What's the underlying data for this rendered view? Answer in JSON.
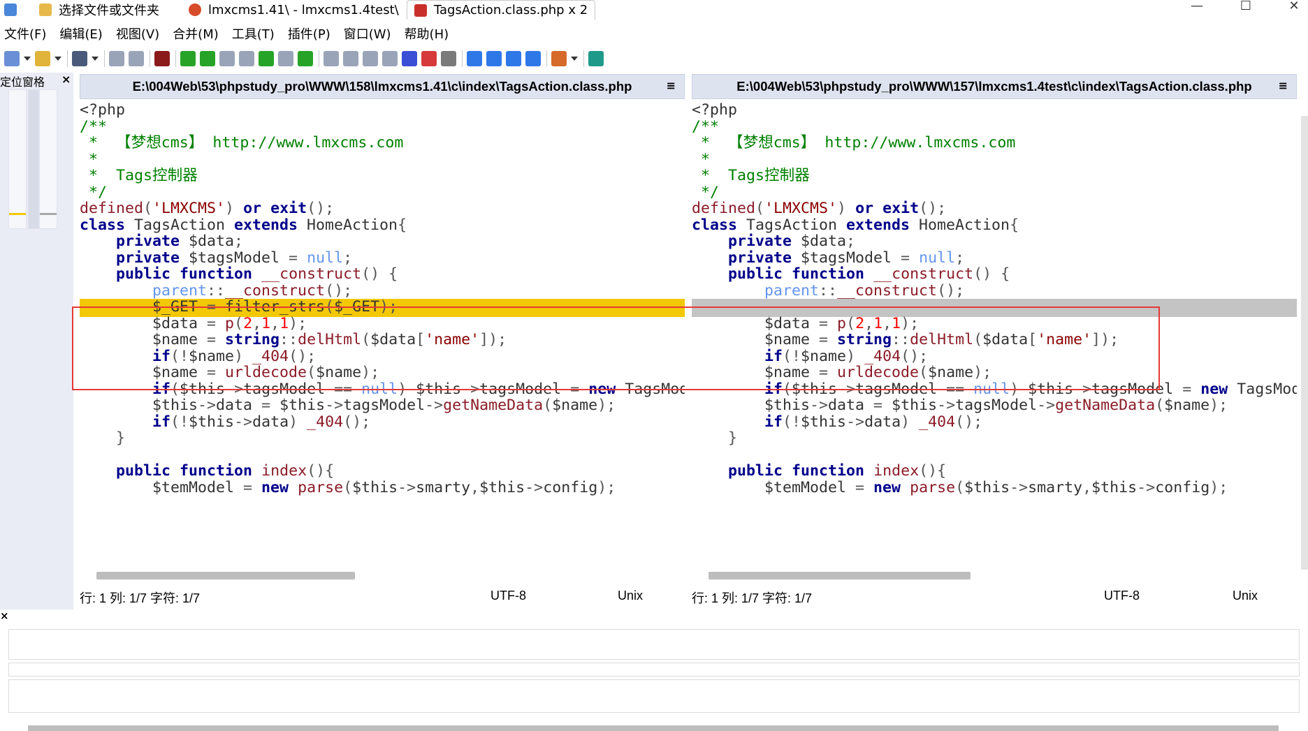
{
  "window": {
    "tabs": [
      {
        "label": "选择文件或文件夹",
        "icon": "folder-compare-icon"
      },
      {
        "label": "lmxcms1.41\\ - lmxcms1.4test\\",
        "icon": "warning-icon"
      },
      {
        "label": "TagsAction.class.php x 2",
        "icon": "file-compare-icon",
        "active": true
      }
    ],
    "controls": {
      "minimize": "—",
      "maximize": "☐",
      "close": "✕"
    }
  },
  "menu": [
    "文件(F)",
    "编辑(E)",
    "视图(V)",
    "合并(M)",
    "工具(T)",
    "插件(P)",
    "窗口(W)",
    "帮助(H)"
  ],
  "locator": {
    "title": "定位窗格",
    "close": "×"
  },
  "panes": {
    "left": {
      "path": "E:\\004Web\\53\\phpstudy_pro\\WWW\\158\\lmxcms1.41\\c\\index\\TagsAction.class.php",
      "menu": "≡",
      "status": {
        "position": "行: 1  列: 1/7  字符: 1/7",
        "encoding": "UTF-8",
        "eol": "Unix"
      },
      "highlight": {
        "line": 12,
        "color": "#f2c807"
      }
    },
    "right": {
      "path": "E:\\004Web\\53\\phpstudy_pro\\WWW\\157\\lmxcms1.4test\\c\\index\\TagsAction.class.php",
      "menu": "≡",
      "status": {
        "position": "行: 1  列: 1/7  字符: 1/7",
        "encoding": "UTF-8",
        "eol": "Unix"
      },
      "highlight": {
        "line": 12,
        "color": "#c4c4c4"
      }
    }
  },
  "code": {
    "left": [
      [
        [
          "tx",
          "<?php"
        ]
      ],
      [
        [
          "cm",
          "/**"
        ]
      ],
      [
        [
          "cm",
          " *  【梦想cms】 http://www.lmxcms.com"
        ]
      ],
      [
        [
          "cm",
          " *"
        ]
      ],
      [
        [
          "cm",
          " *  Tags控制器"
        ]
      ],
      [
        [
          "cm",
          " */"
        ]
      ],
      [
        [
          "fn",
          "defined"
        ],
        [
          "op",
          "("
        ],
        [
          "st",
          "'LMXCMS'"
        ],
        [
          "op",
          ") "
        ],
        [
          "kw",
          "or"
        ],
        [
          "op",
          " "
        ],
        [
          "kw",
          "exit"
        ],
        [
          "op",
          "();"
        ]
      ],
      [
        [
          "kw",
          "class"
        ],
        [
          "tx",
          " TagsAction "
        ],
        [
          "kw",
          "extends"
        ],
        [
          "tx",
          " HomeAction"
        ],
        [
          "op",
          "{"
        ]
      ],
      [
        [
          "tx",
          "    "
        ],
        [
          "kw",
          "private"
        ],
        [
          "tx",
          " $data"
        ],
        [
          "op",
          ";"
        ]
      ],
      [
        [
          "tx",
          "    "
        ],
        [
          "kw",
          "private"
        ],
        [
          "tx",
          " $tagsModel "
        ],
        [
          "op",
          "= "
        ],
        [
          "pl",
          "null"
        ],
        [
          "op",
          ";"
        ]
      ],
      [
        [
          "tx",
          "    "
        ],
        [
          "kw",
          "public"
        ],
        [
          "tx",
          " "
        ],
        [
          "kw",
          "function"
        ],
        [
          "tx",
          " "
        ],
        [
          "fn",
          "__construct"
        ],
        [
          "op",
          "() {"
        ]
      ],
      [
        [
          "tx",
          "        "
        ],
        [
          "pl",
          "parent"
        ],
        [
          "op",
          "::"
        ],
        [
          "fn",
          "__construct"
        ],
        [
          "op",
          "();"
        ]
      ],
      [
        [
          "tx",
          "        $_GET "
        ],
        [
          "op",
          "= "
        ],
        [
          "tx",
          "filter_strs"
        ],
        [
          "op",
          "("
        ],
        [
          "tx",
          "$_GET"
        ],
        [
          "op",
          ");"
        ]
      ],
      [
        [
          "tx",
          "        $data "
        ],
        [
          "op",
          "= "
        ],
        [
          "fn",
          "p"
        ],
        [
          "op",
          "("
        ],
        [
          "nu",
          "2"
        ],
        [
          "op",
          ","
        ],
        [
          "nu",
          "1"
        ],
        [
          "op",
          ","
        ],
        [
          "nu",
          "1"
        ],
        [
          "op",
          ");"
        ]
      ],
      [
        [
          "tx",
          "        $name "
        ],
        [
          "op",
          "= "
        ],
        [
          "kw",
          "string"
        ],
        [
          "op",
          "::"
        ],
        [
          "fn",
          "delHtml"
        ],
        [
          "op",
          "("
        ],
        [
          "tx",
          "$data"
        ],
        [
          "op",
          "["
        ],
        [
          "st",
          "'name'"
        ],
        [
          "op",
          "]);"
        ]
      ],
      [
        [
          "tx",
          "        "
        ],
        [
          "kw",
          "if"
        ],
        [
          "op",
          "(!"
        ],
        [
          "tx",
          "$name"
        ],
        [
          "op",
          ") "
        ],
        [
          "fn",
          "_404"
        ],
        [
          "op",
          "();"
        ]
      ],
      [
        [
          "tx",
          "        $name "
        ],
        [
          "op",
          "= "
        ],
        [
          "fn",
          "urldecode"
        ],
        [
          "op",
          "("
        ],
        [
          "tx",
          "$name"
        ],
        [
          "op",
          ");"
        ]
      ],
      [
        [
          "tx",
          "        "
        ],
        [
          "kw",
          "if"
        ],
        [
          "op",
          "("
        ],
        [
          "tx",
          "$this"
        ],
        [
          "op",
          "->"
        ],
        [
          "tx",
          "tagsModel "
        ],
        [
          "op",
          "== "
        ],
        [
          "pl",
          "null"
        ],
        [
          "op",
          ") "
        ],
        [
          "tx",
          "$this"
        ],
        [
          "op",
          "->"
        ],
        [
          "tx",
          "tagsModel "
        ],
        [
          "op",
          "= "
        ],
        [
          "kw",
          "new"
        ],
        [
          "tx",
          " TagsModel();"
        ]
      ],
      [
        [
          "tx",
          "        $this"
        ],
        [
          "op",
          "->"
        ],
        [
          "tx",
          "data "
        ],
        [
          "op",
          "= "
        ],
        [
          "tx",
          "$this"
        ],
        [
          "op",
          "->"
        ],
        [
          "tx",
          "tagsModel"
        ],
        [
          "op",
          "->"
        ],
        [
          "fn",
          "getNameData"
        ],
        [
          "op",
          "("
        ],
        [
          "tx",
          "$name"
        ],
        [
          "op",
          ");"
        ]
      ],
      [
        [
          "tx",
          "        "
        ],
        [
          "kw",
          "if"
        ],
        [
          "op",
          "(!"
        ],
        [
          "tx",
          "$this"
        ],
        [
          "op",
          "->"
        ],
        [
          "tx",
          "data"
        ],
        [
          "op",
          ") "
        ],
        [
          "fn",
          "_404"
        ],
        [
          "op",
          "();"
        ]
      ],
      [
        [
          "op",
          "    }"
        ]
      ],
      [
        [
          "tx",
          ""
        ]
      ],
      [
        [
          "tx",
          "    "
        ],
        [
          "kw",
          "public"
        ],
        [
          "tx",
          " "
        ],
        [
          "kw",
          "function"
        ],
        [
          "tx",
          " "
        ],
        [
          "fn",
          "index"
        ],
        [
          "op",
          "(){"
        ]
      ],
      [
        [
          "tx",
          "        $temModel "
        ],
        [
          "op",
          "= "
        ],
        [
          "kw",
          "new"
        ],
        [
          "tx",
          " "
        ],
        [
          "fn",
          "parse"
        ],
        [
          "op",
          "("
        ],
        [
          "tx",
          "$this"
        ],
        [
          "op",
          "->"
        ],
        [
          "tx",
          "smarty"
        ],
        [
          "op",
          ","
        ],
        [
          "tx",
          "$this"
        ],
        [
          "op",
          "->"
        ],
        [
          "tx",
          "config"
        ],
        [
          "op",
          ");"
        ]
      ]
    ],
    "right": [
      [
        [
          "tx",
          "<?php"
        ]
      ],
      [
        [
          "cm",
          "/**"
        ]
      ],
      [
        [
          "cm",
          " *  【梦想cms】 http://www.lmxcms.com"
        ]
      ],
      [
        [
          "cm",
          " *"
        ]
      ],
      [
        [
          "cm",
          " *  Tags控制器"
        ]
      ],
      [
        [
          "cm",
          " */"
        ]
      ],
      [
        [
          "fn",
          "defined"
        ],
        [
          "op",
          "("
        ],
        [
          "st",
          "'LMXCMS'"
        ],
        [
          "op",
          ") "
        ],
        [
          "kw",
          "or"
        ],
        [
          "op",
          " "
        ],
        [
          "kw",
          "exit"
        ],
        [
          "op",
          "();"
        ]
      ],
      [
        [
          "kw",
          "class"
        ],
        [
          "tx",
          " TagsAction "
        ],
        [
          "kw",
          "extends"
        ],
        [
          "tx",
          " HomeAction"
        ],
        [
          "op",
          "{"
        ]
      ],
      [
        [
          "tx",
          "    "
        ],
        [
          "kw",
          "private"
        ],
        [
          "tx",
          " $data"
        ],
        [
          "op",
          ";"
        ]
      ],
      [
        [
          "tx",
          "    "
        ],
        [
          "kw",
          "private"
        ],
        [
          "tx",
          " $tagsModel "
        ],
        [
          "op",
          "= "
        ],
        [
          "pl",
          "null"
        ],
        [
          "op",
          ";"
        ]
      ],
      [
        [
          "tx",
          "    "
        ],
        [
          "kw",
          "public"
        ],
        [
          "tx",
          " "
        ],
        [
          "kw",
          "function"
        ],
        [
          "tx",
          " "
        ],
        [
          "fn",
          "__construct"
        ],
        [
          "op",
          "() {"
        ]
      ],
      [
        [
          "tx",
          "        "
        ],
        [
          "pl",
          "parent"
        ],
        [
          "op",
          "::"
        ],
        [
          "fn",
          "__construct"
        ],
        [
          "op",
          "();"
        ]
      ],
      [
        [
          "tx",
          ""
        ]
      ],
      [
        [
          "tx",
          "        $data "
        ],
        [
          "op",
          "= "
        ],
        [
          "fn",
          "p"
        ],
        [
          "op",
          "("
        ],
        [
          "nu",
          "2"
        ],
        [
          "op",
          ","
        ],
        [
          "nu",
          "1"
        ],
        [
          "op",
          ","
        ],
        [
          "nu",
          "1"
        ],
        [
          "op",
          ");"
        ]
      ],
      [
        [
          "tx",
          "        $name "
        ],
        [
          "op",
          "= "
        ],
        [
          "kw",
          "string"
        ],
        [
          "op",
          "::"
        ],
        [
          "fn",
          "delHtml"
        ],
        [
          "op",
          "("
        ],
        [
          "tx",
          "$data"
        ],
        [
          "op",
          "["
        ],
        [
          "st",
          "'name'"
        ],
        [
          "op",
          "]);"
        ]
      ],
      [
        [
          "tx",
          "        "
        ],
        [
          "kw",
          "if"
        ],
        [
          "op",
          "(!"
        ],
        [
          "tx",
          "$name"
        ],
        [
          "op",
          ") "
        ],
        [
          "fn",
          "_404"
        ],
        [
          "op",
          "();"
        ]
      ],
      [
        [
          "tx",
          "        $name "
        ],
        [
          "op",
          "= "
        ],
        [
          "fn",
          "urldecode"
        ],
        [
          "op",
          "("
        ],
        [
          "tx",
          "$name"
        ],
        [
          "op",
          ");"
        ]
      ],
      [
        [
          "tx",
          "        "
        ],
        [
          "kw",
          "if"
        ],
        [
          "op",
          "("
        ],
        [
          "tx",
          "$this"
        ],
        [
          "op",
          "->"
        ],
        [
          "tx",
          "tagsModel "
        ],
        [
          "op",
          "== "
        ],
        [
          "pl",
          "null"
        ],
        [
          "op",
          ") "
        ],
        [
          "tx",
          "$this"
        ],
        [
          "op",
          "->"
        ],
        [
          "tx",
          "tagsModel "
        ],
        [
          "op",
          "= "
        ],
        [
          "kw",
          "new"
        ],
        [
          "tx",
          " TagsModel();"
        ]
      ],
      [
        [
          "tx",
          "        $this"
        ],
        [
          "op",
          "->"
        ],
        [
          "tx",
          "data "
        ],
        [
          "op",
          "= "
        ],
        [
          "tx",
          "$this"
        ],
        [
          "op",
          "->"
        ],
        [
          "tx",
          "tagsModel"
        ],
        [
          "op",
          "->"
        ],
        [
          "fn",
          "getNameData"
        ],
        [
          "op",
          "("
        ],
        [
          "tx",
          "$name"
        ],
        [
          "op",
          ");"
        ]
      ],
      [
        [
          "tx",
          "        "
        ],
        [
          "kw",
          "if"
        ],
        [
          "op",
          "(!"
        ],
        [
          "tx",
          "$this"
        ],
        [
          "op",
          "->"
        ],
        [
          "tx",
          "data"
        ],
        [
          "op",
          ") "
        ],
        [
          "fn",
          "_404"
        ],
        [
          "op",
          "();"
        ]
      ],
      [
        [
          "op",
          "    }"
        ]
      ],
      [
        [
          "tx",
          ""
        ]
      ],
      [
        [
          "tx",
          "    "
        ],
        [
          "kw",
          "public"
        ],
        [
          "tx",
          " "
        ],
        [
          "kw",
          "function"
        ],
        [
          "tx",
          " "
        ],
        [
          "fn",
          "index"
        ],
        [
          "op",
          "(){"
        ]
      ],
      [
        [
          "tx",
          "        $temModel "
        ],
        [
          "op",
          "= "
        ],
        [
          "kw",
          "new"
        ],
        [
          "tx",
          " "
        ],
        [
          "fn",
          "parse"
        ],
        [
          "op",
          "("
        ],
        [
          "tx",
          "$this"
        ],
        [
          "op",
          "->"
        ],
        [
          "tx",
          "smarty"
        ],
        [
          "op",
          ","
        ],
        [
          "tx",
          "$this"
        ],
        [
          "op",
          "->"
        ],
        [
          "tx",
          "config"
        ],
        [
          "op",
          ");"
        ]
      ]
    ]
  },
  "toolbar": {
    "buttons": [
      {
        "icon": "new-file-icon",
        "color": "#6a8fd6"
      },
      {
        "icon": "open-folder-icon",
        "color": "#e0b33a"
      },
      {
        "icon": "save-icon",
        "color": "#4a5a7a"
      },
      {
        "icon": "undo-icon",
        "color": "#9aa4b8"
      },
      {
        "icon": "redo-icon",
        "color": "#9aa4b8"
      },
      {
        "icon": "film-icon",
        "color": "#8b1a1a"
      },
      {
        "icon": "merge-down-icon",
        "color": "#27a327"
      },
      {
        "icon": "merge-up-icon",
        "color": "#27a327"
      },
      {
        "icon": "copy-down-icon",
        "color": "#9aa4b8"
      },
      {
        "icon": "copy-up-icon",
        "color": "#9aa4b8"
      },
      {
        "icon": "merge-all-icon",
        "color": "#27a327"
      },
      {
        "icon": "merge-conflict-icon",
        "color": "#9aa4b8"
      },
      {
        "icon": "accept-all-icon",
        "color": "#27a327"
      },
      {
        "icon": "copy-right-icon",
        "color": "#9aa4b8"
      },
      {
        "icon": "copy-left-icon",
        "color": "#9aa4b8"
      },
      {
        "icon": "copy-right-advance-icon",
        "color": "#9aa4b8"
      },
      {
        "icon": "copy-left-advance-icon",
        "color": "#9aa4b8"
      },
      {
        "icon": "all-right-icon",
        "color": "#3a4fd6"
      },
      {
        "icon": "all-left-icon",
        "color": "#d63a3a"
      },
      {
        "icon": "delete-icon",
        "color": "#7a7a7a"
      },
      {
        "icon": "first-diff-icon",
        "color": "#2f78e8"
      },
      {
        "icon": "prev-diff-icon",
        "color": "#2f78e8"
      },
      {
        "icon": "next-diff-icon",
        "color": "#2f78e8"
      },
      {
        "icon": "last-diff-icon",
        "color": "#2f78e8"
      },
      {
        "icon": "options-icon",
        "color": "#d66a2a"
      },
      {
        "icon": "refresh-icon",
        "color": "#1f9a8a"
      }
    ]
  }
}
